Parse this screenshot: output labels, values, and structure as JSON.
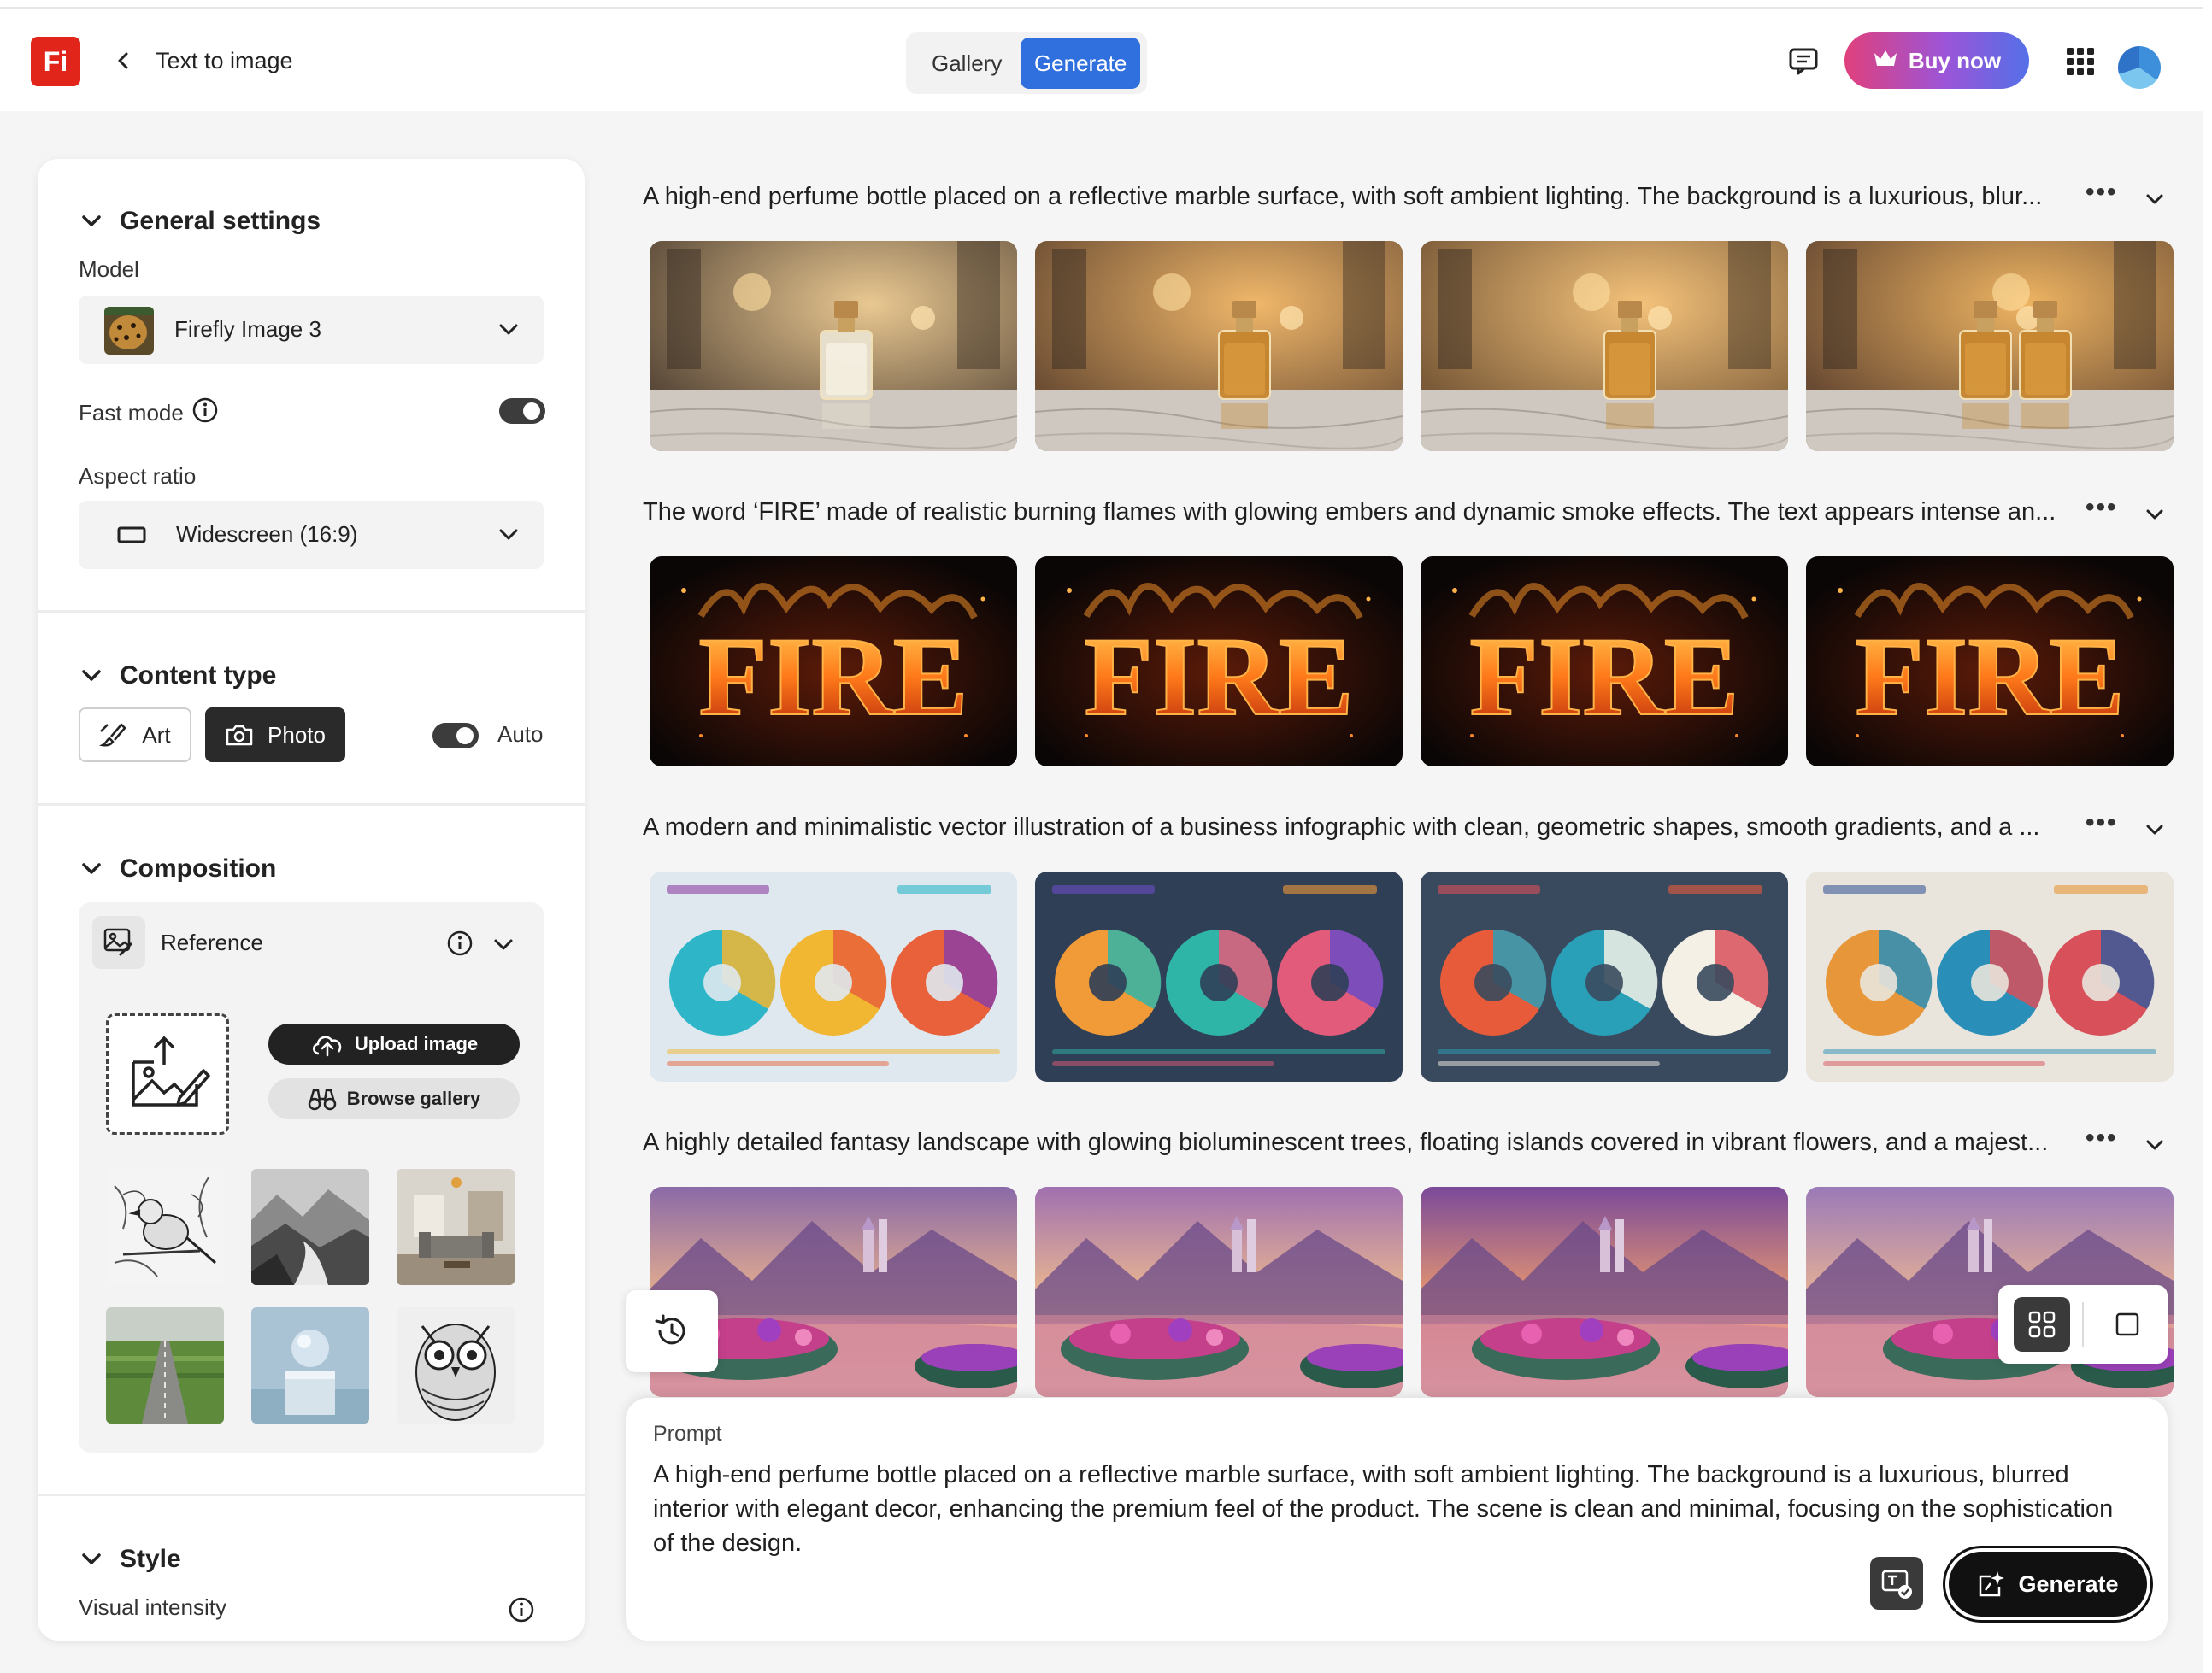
{
  "header": {
    "logo": "Fi",
    "title": "Text to image",
    "tabs": {
      "gallery": "Gallery",
      "generate": "Generate"
    },
    "buy_now": "Buy now",
    "icons": [
      "chevron-left-icon",
      "comment-icon",
      "crown-icon",
      "app-grid-icon",
      "avatar"
    ]
  },
  "sidebar": {
    "general": {
      "heading": "General settings",
      "model_label": "Model",
      "model_value": "Firefly Image 3",
      "fast_mode_label": "Fast mode",
      "fast_mode_on": true,
      "aspect_label": "Aspect ratio",
      "aspect_value": "Widescreen (16:9)"
    },
    "content_type": {
      "heading": "Content type",
      "art": "Art",
      "photo": "Photo",
      "auto": "Auto",
      "auto_on": true,
      "selected": "Photo"
    },
    "composition": {
      "heading": "Composition",
      "reference": "Reference",
      "upload": "Upload image",
      "browse": "Browse gallery",
      "thumbnails": [
        "bird-sketch",
        "misty-mountains",
        "living-room",
        "green-field-road",
        "sphere-on-pedestal",
        "owl-sketch"
      ]
    },
    "style": {
      "heading": "Style",
      "visual_intensity": "Visual intensity"
    }
  },
  "results": [
    {
      "prompt": "A high-end perfume bottle placed on a reflective marble surface, with soft ambient lighting. The background is a luxurious, blur...",
      "theme": "perfume"
    },
    {
      "prompt": "The word ‘FIRE’ made of realistic burning flames with glowing embers and dynamic smoke effects. The text appears intense an...",
      "theme": "fire",
      "word": "FIRE"
    },
    {
      "prompt": "A modern and minimalistic vector illustration of a business infographic with clean, geometric shapes, smooth gradients, and a ...",
      "theme": "infographic"
    },
    {
      "prompt": "A highly detailed fantasy landscape with glowing bioluminescent trees, floating islands covered in vibrant flowers, and a majest...",
      "theme": "fantasy"
    }
  ],
  "more_glyph": "•••",
  "prompt_box": {
    "label": "Prompt",
    "text": "A high-end perfume bottle placed on a reflective marble surface, with soft ambient lighting. The background is a luxurious, blurred interior with elegant decor, enhancing the premium feel of the product. The scene is clean and minimal, focusing on the sophistication of the design.",
    "generate": "Generate"
  },
  "colors": {
    "accent": "#2f6fde",
    "logo": "#e1251b",
    "dark": "#2a2a2a"
  }
}
